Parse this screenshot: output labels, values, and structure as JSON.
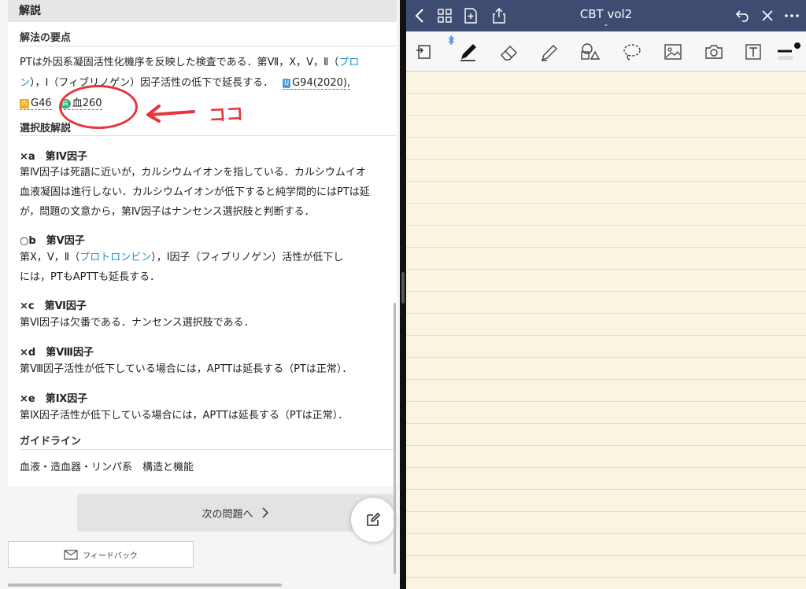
{
  "left_panel": {
    "header": "解説",
    "points_title": "解法の要点",
    "pt_line1_a": "PTは外因系凝固活性化機序を反映した検査である．第Ⅶ，Ⅹ，Ⅴ，Ⅱ（",
    "pt_line1_link": "プロ",
    "pt_line2_link": "ン",
    "pt_line2_b": "），Ⅰ（フィブリノゲン）因子活性の低下で延長する．",
    "ref1_badge": "U",
    "ref1": "G94(2020),",
    "ref2_badge": "内",
    "ref2": "G46",
    "ref3_badge": "病",
    "ref3": "血260",
    "annotation": "ココ",
    "choices_title": "選択肢解説",
    "choices": [
      {
        "label": "×a　第Ⅳ因子",
        "lines": [
          "第Ⅳ因子は死語に近いが，カルシウムイオンを指している．カルシウムイオ",
          "血液凝固は進行しない．カルシウムイオンが低下すると純学問的にはPTは延",
          "が，問題の文意から，第Ⅳ因子はナンセンス選択肢と判断する．"
        ]
      },
      {
        "label": "○b　第Ⅴ因子",
        "line1_a": "第Ⅹ，Ⅴ，Ⅱ（",
        "line1_link": "プロトロンビン",
        "line1_b": "），Ⅰ因子（フィブリノゲン）活性が低下し",
        "line2": "には，PTもAPTTも延長する．"
      },
      {
        "label": "×c　第Ⅵ因子",
        "lines": [
          "第Ⅵ因子は欠番である．ナンセンス選択肢である．"
        ]
      },
      {
        "label": "×d　第Ⅷ因子",
        "lines": [
          "第Ⅷ因子活性が低下している場合には，APTTは延長する（PTは正常）．"
        ]
      },
      {
        "label": "×e　第Ⅸ因子",
        "lines": [
          "第Ⅸ因子活性が低下している場合には，APTTは延長する（PTは正常）．"
        ]
      }
    ],
    "guideline_title": "ガイドライン",
    "guideline_text": "血液・造血器・リンパ系　構造と機能",
    "next_label": "次の問題へ",
    "feedback_label": "フィードバック"
  },
  "right_panel": {
    "title": "CBT vol2",
    "subtitle_chevron": "⌄"
  },
  "colors": {
    "accent_link": "#1e8fc8",
    "annotation_red": "#e8343a",
    "nav_bar": "#3d4c70",
    "paper": "#faf5e1"
  }
}
